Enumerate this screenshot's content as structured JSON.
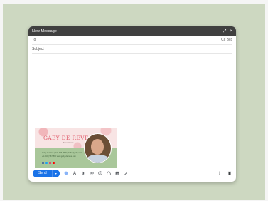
{
  "compose": {
    "title": "New Message",
    "controls": {
      "minimize": "_",
      "expand": "⤢",
      "close": "×"
    },
    "to_label": "To",
    "cc_bcc": "Cc Bcc",
    "subject_label": "Subject",
    "send_label": "Send",
    "send_menu": "▾"
  },
  "signature": {
    "name": "GABY DE RÊVE",
    "subtitle": "Freelancer",
    "line1": "Gaby de Rêve | 123-456-7890 | hello@gaby.com",
    "line2": "+1 (234) 567-890   www.gaby-de-reve.com",
    "social_colors": [
      "#3b5998",
      "#1da1f2",
      "#e1306c",
      "#ff0000"
    ]
  },
  "colors": {
    "accent": "#1a73e8",
    "title_bar": "#404040",
    "page_background": "#cdd8c1"
  },
  "icons": [
    "formatting-icon",
    "attach-icon",
    "link-icon",
    "emoji-icon",
    "drive-icon",
    "photo-icon",
    "lock-icon",
    "signature-icon",
    "more-options-icon",
    "discard-icon"
  ]
}
